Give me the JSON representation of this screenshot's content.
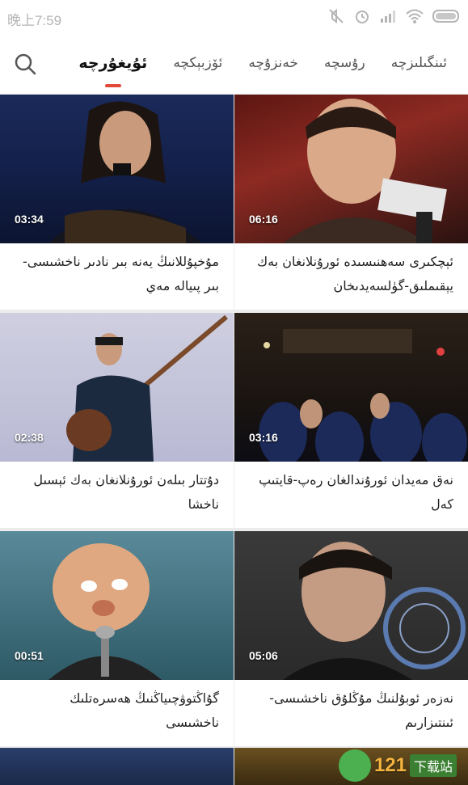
{
  "status": {
    "time": "晚上7:59",
    "icons": [
      "mute-icon",
      "alarm-icon",
      "signal-icon",
      "wifi-icon",
      "battery-icon"
    ]
  },
  "nav": {
    "search_icon": "search-icon",
    "tabs": [
      {
        "label": "ئۇيغۇرچە",
        "active": true
      },
      {
        "label": "ئۆزبېكچە",
        "active": false
      },
      {
        "label": "خەنزۇچە",
        "active": false
      },
      {
        "label": "رۇسچە",
        "active": false
      },
      {
        "label": "ئىنگىلىزچە",
        "active": false
      }
    ],
    "accent": "#e24a3b"
  },
  "videos": [
    {
      "duration": "06:16",
      "title": "ئېچكىرى سەھنىسىدە ئورۇنلانغان بەك يېقىملىق-گۈلسەيدىخان"
    },
    {
      "duration": "03:34",
      "title": "مۇخپۇللانىڭ يەنە بىر نادىر ناخشىسى-بىر پىيالە مەي"
    },
    {
      "duration": "03:16",
      "title": "نەق مەيدان ئورۇندالغان رەپ-قايتىپ كەل"
    },
    {
      "duration": "02:38",
      "title": "دۇتتار بىلەن ئورۇنلانغان بەك ئېسىل ناخشا"
    },
    {
      "duration": "05:06",
      "title": "نەزەر ئوبۇلنىڭ مۇڭلۇق ناخشىسى-ئىنتىزارىم"
    },
    {
      "duration": "00:51",
      "title": "گۇاڭتوۋچىياڭنىڭ ھەسرەتلىك ناخشىسى"
    }
  ],
  "watermark": {
    "number": "121",
    "site": "下载站"
  }
}
